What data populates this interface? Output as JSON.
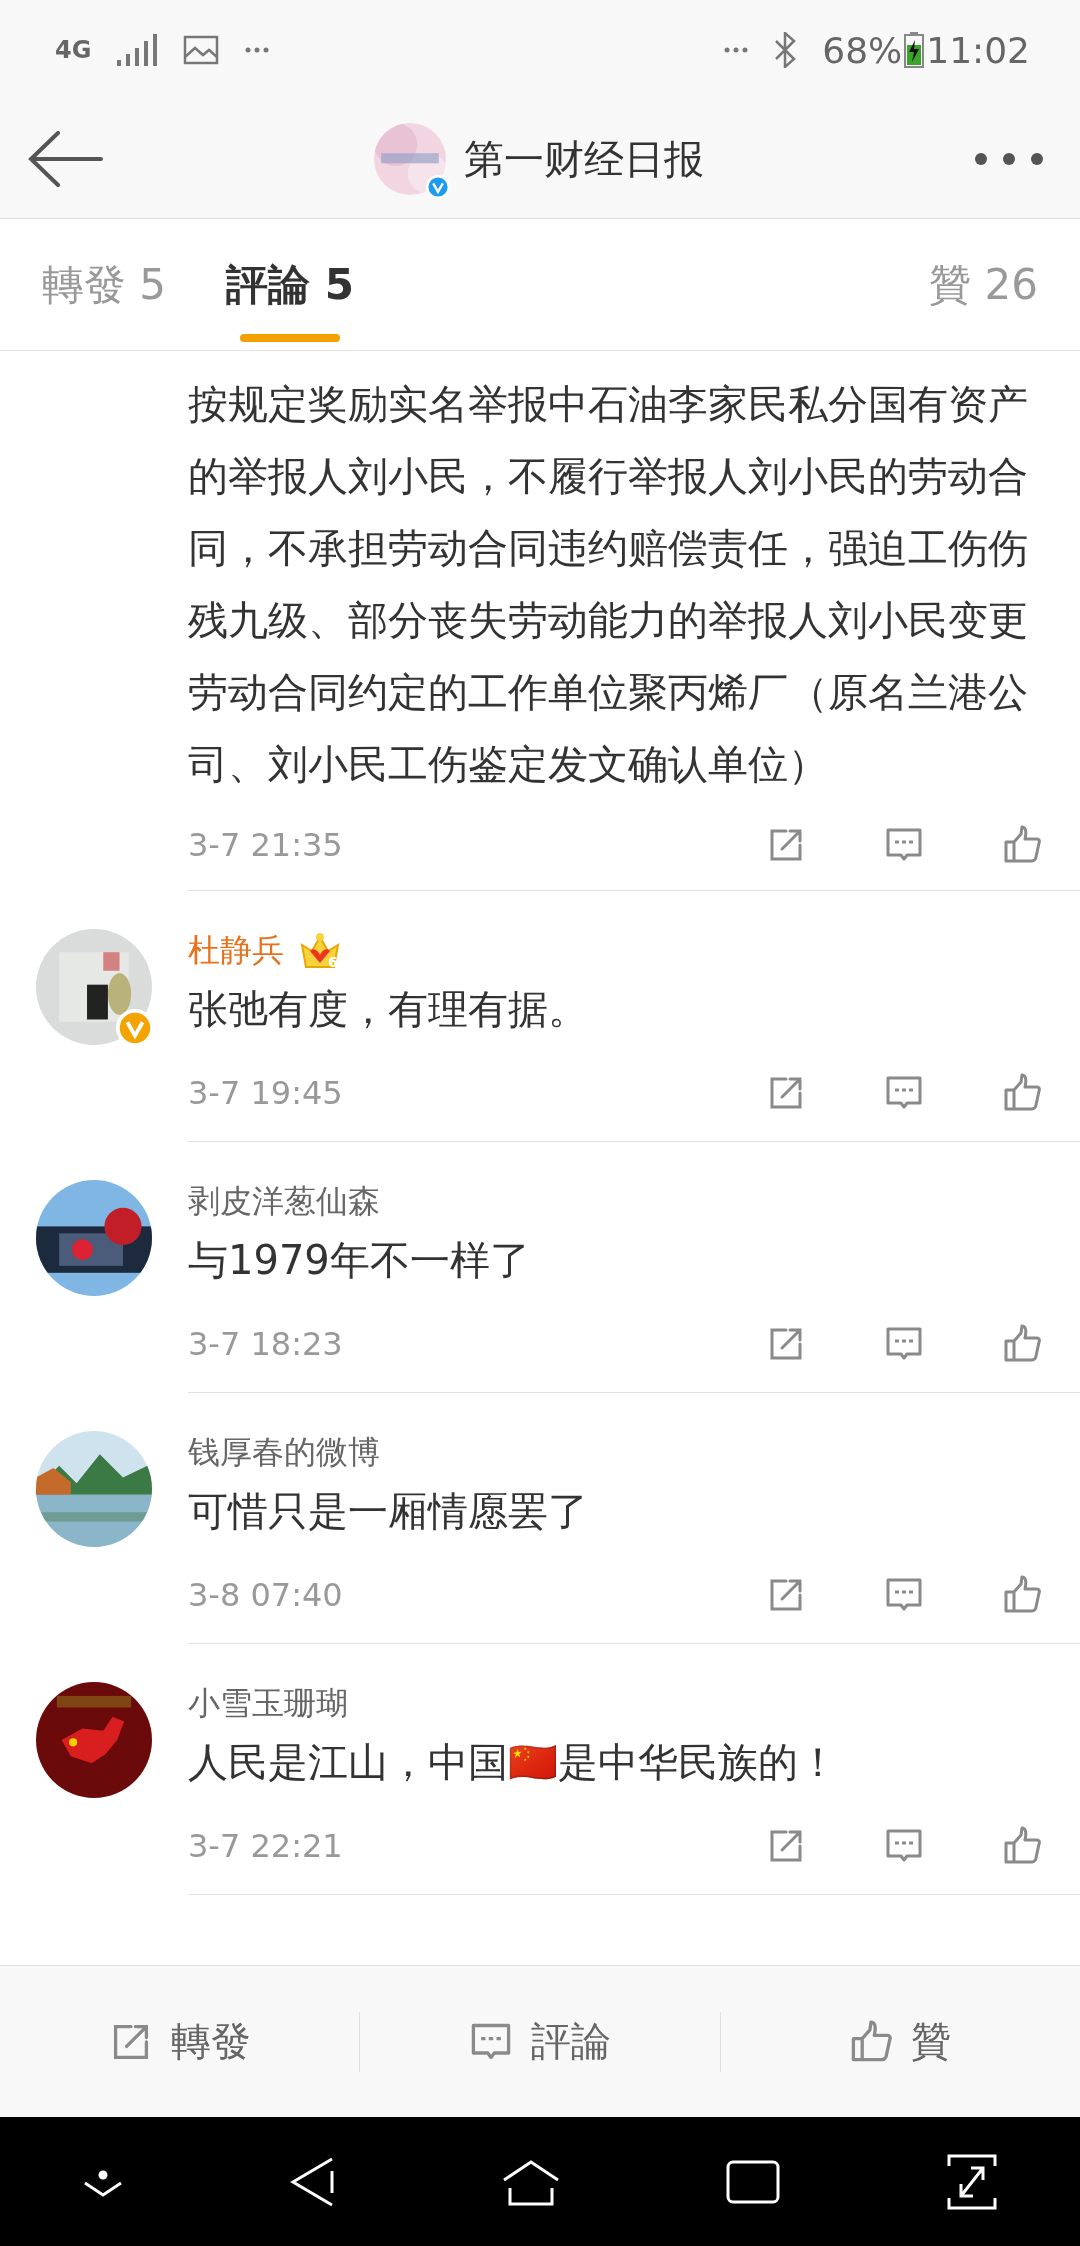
{
  "status_bar": {
    "network": "4G",
    "battery": "68%",
    "time": "11:02"
  },
  "header": {
    "title": "第一财经日报",
    "verified": true
  },
  "tabs": [
    {
      "label": "轉發",
      "count": "5",
      "selected": false
    },
    {
      "label": "評論",
      "count": "5",
      "selected": true
    },
    {
      "label": "贊",
      "count": "26",
      "selected": false
    }
  ],
  "comments": [
    {
      "text": "按规定奖励实名举报中石油李家民私分国有资产的举报人刘小民，不履行举报人刘小民的劳动合同，不承担劳动合同违约赔偿责任，强迫工伤伤残九级、部分丧失劳动能力的举报人刘小民变更劳动合同约定的工作单位聚丙烯厂（原名兰港公司、刘小民工伤鉴定发文确认单位）",
      "time": "3-7 21:35"
    },
    {
      "name": "杜静兵",
      "vip": true,
      "vip_level": "6",
      "verified": true,
      "text": "张弛有度，有理有据。",
      "time": "3-7 19:45"
    },
    {
      "name": "剥皮洋葱仙森",
      "vip": false,
      "verified": false,
      "text": "与1979年不一样了",
      "time": "3-7 18:23"
    },
    {
      "name": "钱厚春的微博",
      "vip": false,
      "verified": false,
      "text": "可惜只是一厢情愿罢了",
      "time": "3-8 07:40"
    },
    {
      "name": "小雪玉珊瑚",
      "vip": false,
      "verified": false,
      "text": "人民是江山，中国🇨🇳是中华民族的！",
      "time": "3-7 22:21"
    }
  ],
  "actions": [
    {
      "kind": "repost",
      "label": "轉發"
    },
    {
      "kind": "comment",
      "label": "評論"
    },
    {
      "kind": "like",
      "label": "贊"
    }
  ]
}
